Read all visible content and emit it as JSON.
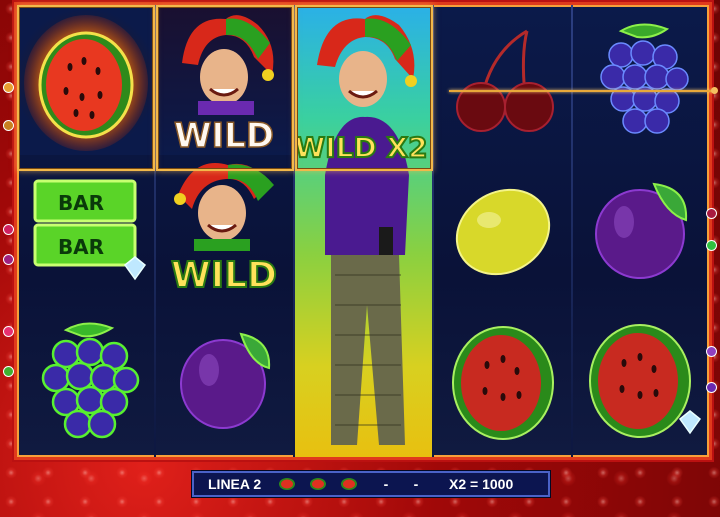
{
  "game": {
    "reels": [
      {
        "symbols": [
          "watermelon-fire",
          "bar-bar",
          "grapes"
        ]
      },
      {
        "symbols": [
          "joker-wild",
          "joker-wild",
          "plum"
        ]
      },
      {
        "symbols": [
          "joker-wild-x2",
          "joker-body",
          "joker-body"
        ]
      },
      {
        "symbols": [
          "cherries",
          "lemon",
          "watermelon"
        ]
      },
      {
        "symbols": [
          "grapes",
          "plum",
          "watermelon"
        ]
      }
    ],
    "wild_label": "WILD",
    "wild_x2_label": "WILD X2",
    "bar_label": "BAR"
  },
  "bottom_bar": {
    "line_label": "LINEA 2",
    "symbols": [
      "watermelon",
      "watermelon",
      "watermelon"
    ],
    "dash1": "-",
    "dash2": "-",
    "payout": "X2 = 1000"
  },
  "colors": {
    "frame": "#e03a1c",
    "payline": "#e8a83a",
    "bar_bg": "#0c1550"
  }
}
